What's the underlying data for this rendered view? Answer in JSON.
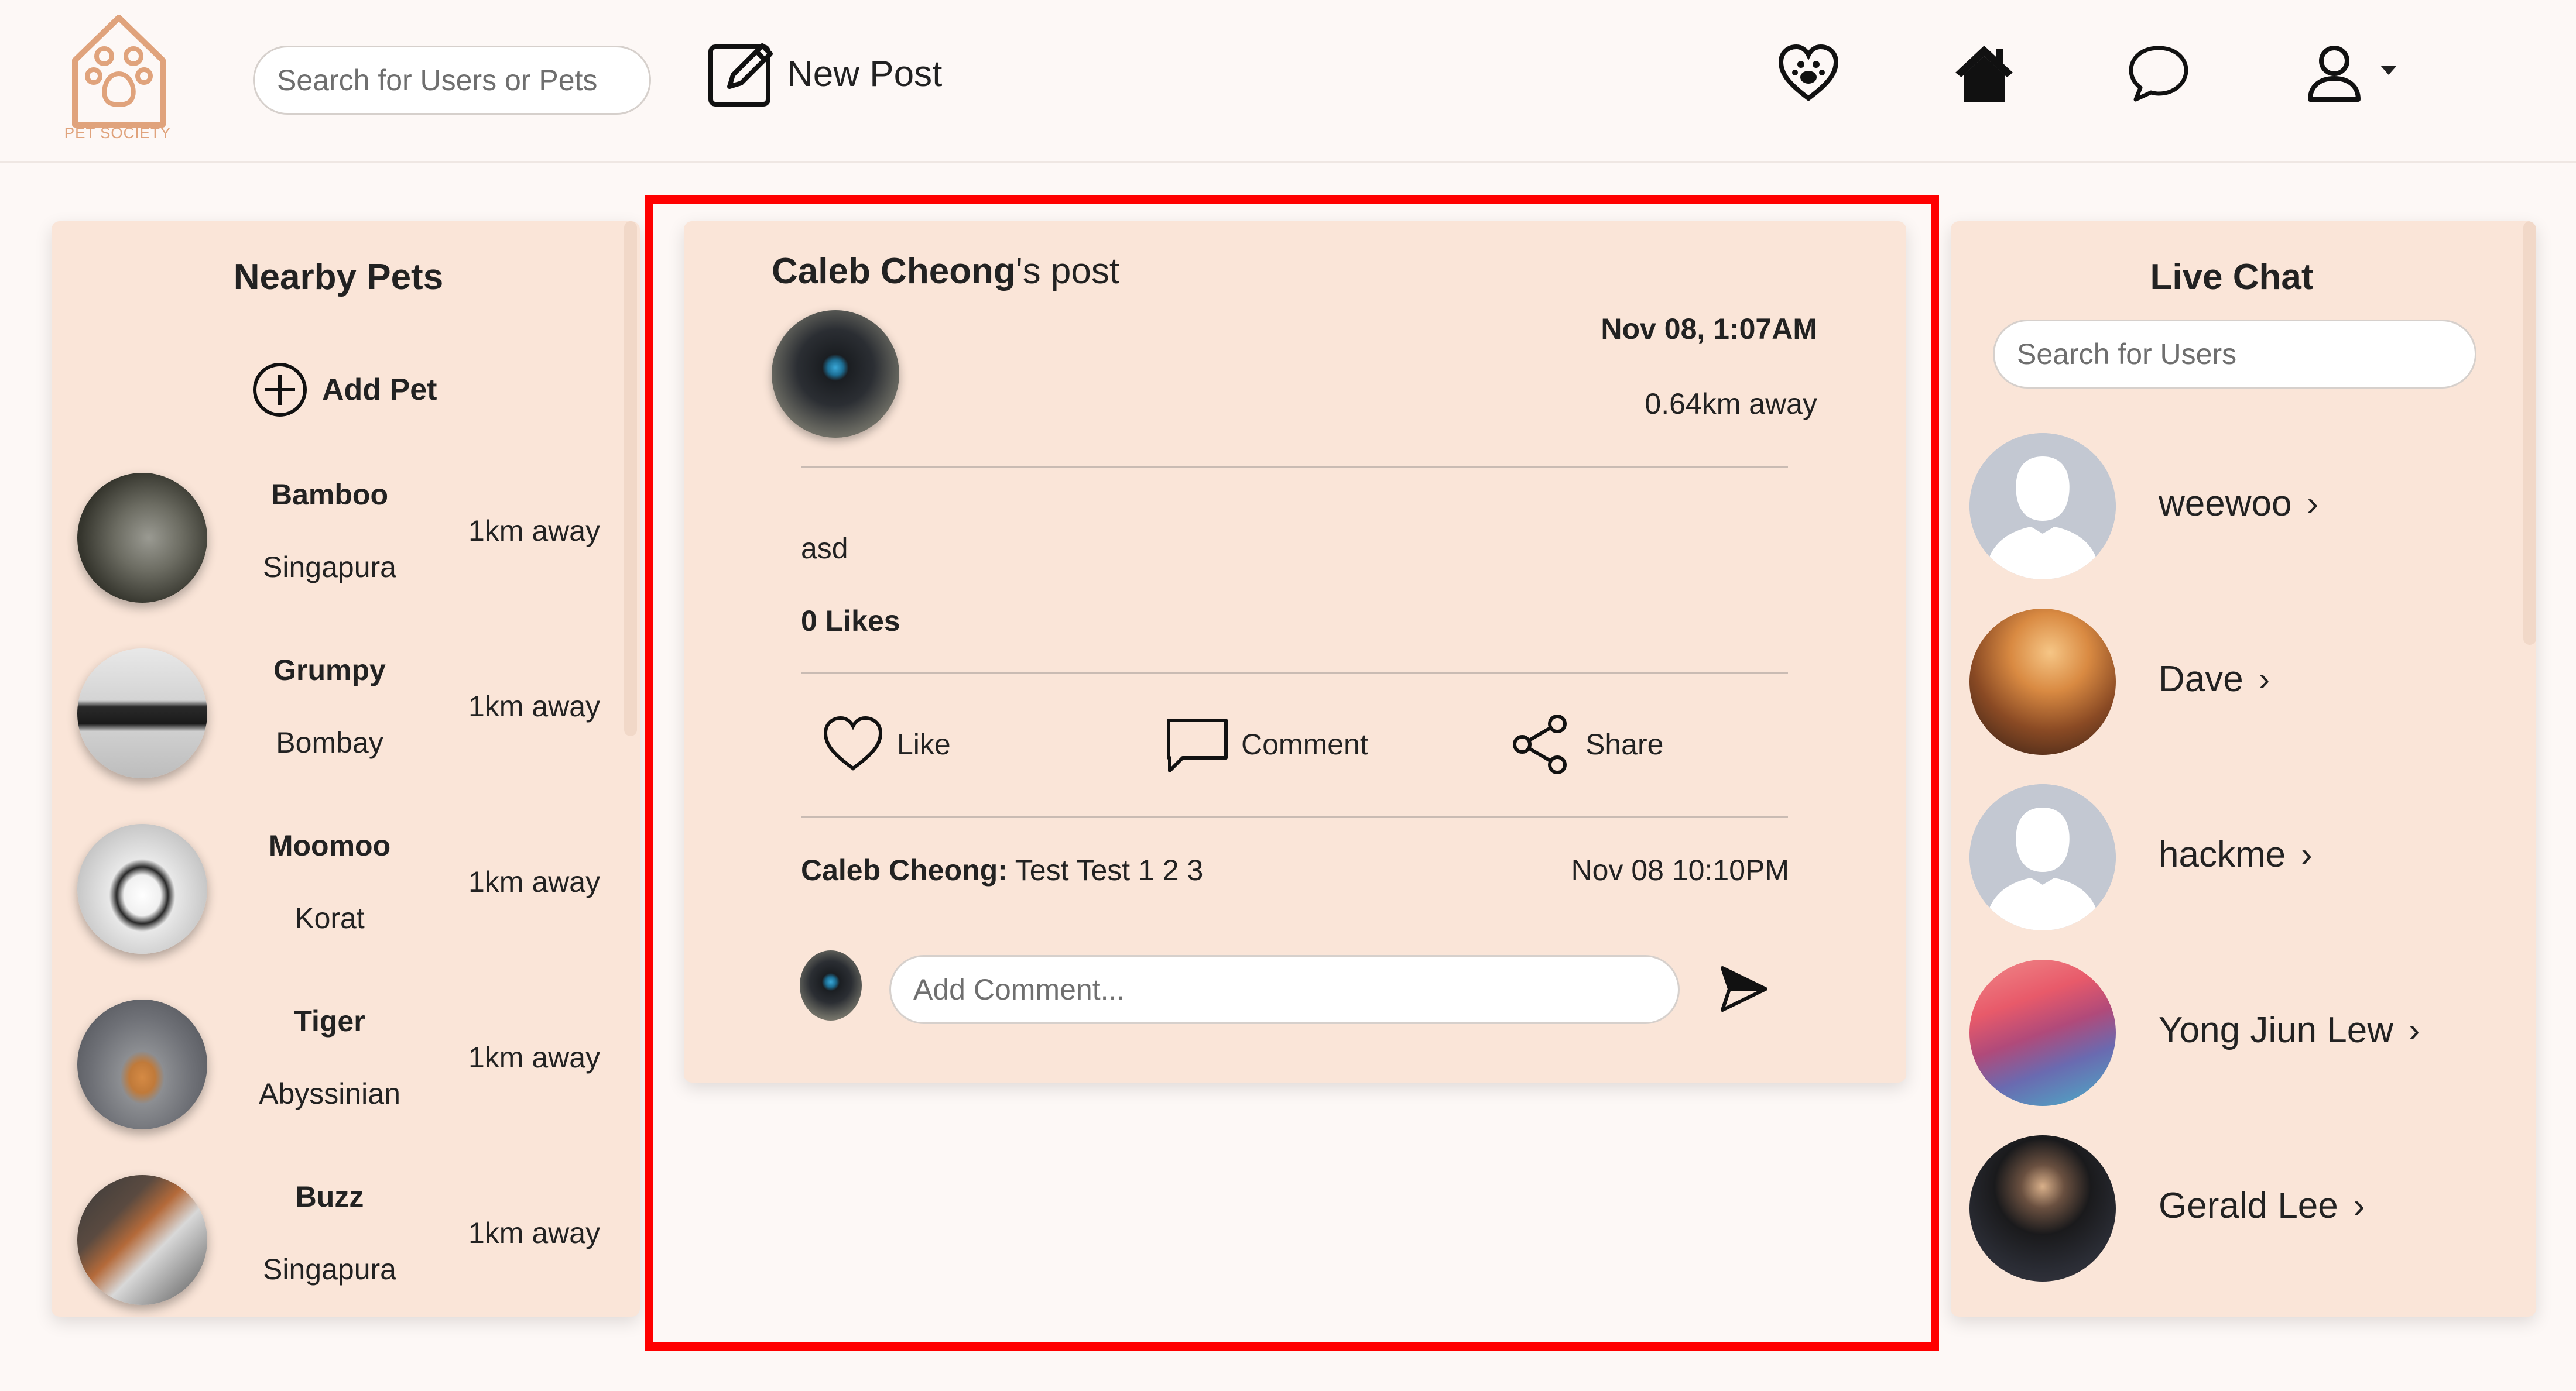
{
  "nav": {
    "logo_text": "PET SOCIETY",
    "search_placeholder": "Search for Users or Pets",
    "new_post_label": "New Post",
    "icons": [
      "paw-heart-icon",
      "home-icon",
      "chat-bubble-icon",
      "user-icon",
      "caret-down-icon"
    ]
  },
  "nearby": {
    "title": "Nearby Pets",
    "add_pet_label": "Add Pet",
    "pets": [
      {
        "name": "Bamboo",
        "breed": "Singapura",
        "distance": "1km away"
      },
      {
        "name": "Grumpy",
        "breed": "Bombay",
        "distance": "1km away"
      },
      {
        "name": "Moomoo",
        "breed": "Korat",
        "distance": "1km away"
      },
      {
        "name": "Tiger",
        "breed": "Abyssinian",
        "distance": "1km away"
      },
      {
        "name": "Buzz",
        "breed": "Singapura",
        "distance": "1km away"
      }
    ]
  },
  "post": {
    "author": "Caleb Cheong",
    "title_suffix": "'s post",
    "date": "Nov 08, 1:07AM",
    "distance": "0.64km away",
    "body": "asd",
    "likes": "0 Likes",
    "actions": {
      "like": "Like",
      "comment": "Comment",
      "share": "Share"
    },
    "comment": {
      "author": "Caleb Cheong:",
      "text": " Test Test 1 2 3",
      "time": "Nov 08 10:10PM"
    },
    "comment_placeholder": "Add Comment..."
  },
  "chat": {
    "title": "Live Chat",
    "search_placeholder": "Search for Users",
    "users": [
      {
        "name": "weewoo"
      },
      {
        "name": "Dave"
      },
      {
        "name": "hackme"
      },
      {
        "name": "Yong Jiun Lew"
      },
      {
        "name": "Gerald Lee"
      }
    ]
  },
  "colors": {
    "panel_bg": "#fae5d8",
    "page_bg": "#fdf8f6",
    "logo": "#e0a37c",
    "highlight": "#ff0000"
  }
}
